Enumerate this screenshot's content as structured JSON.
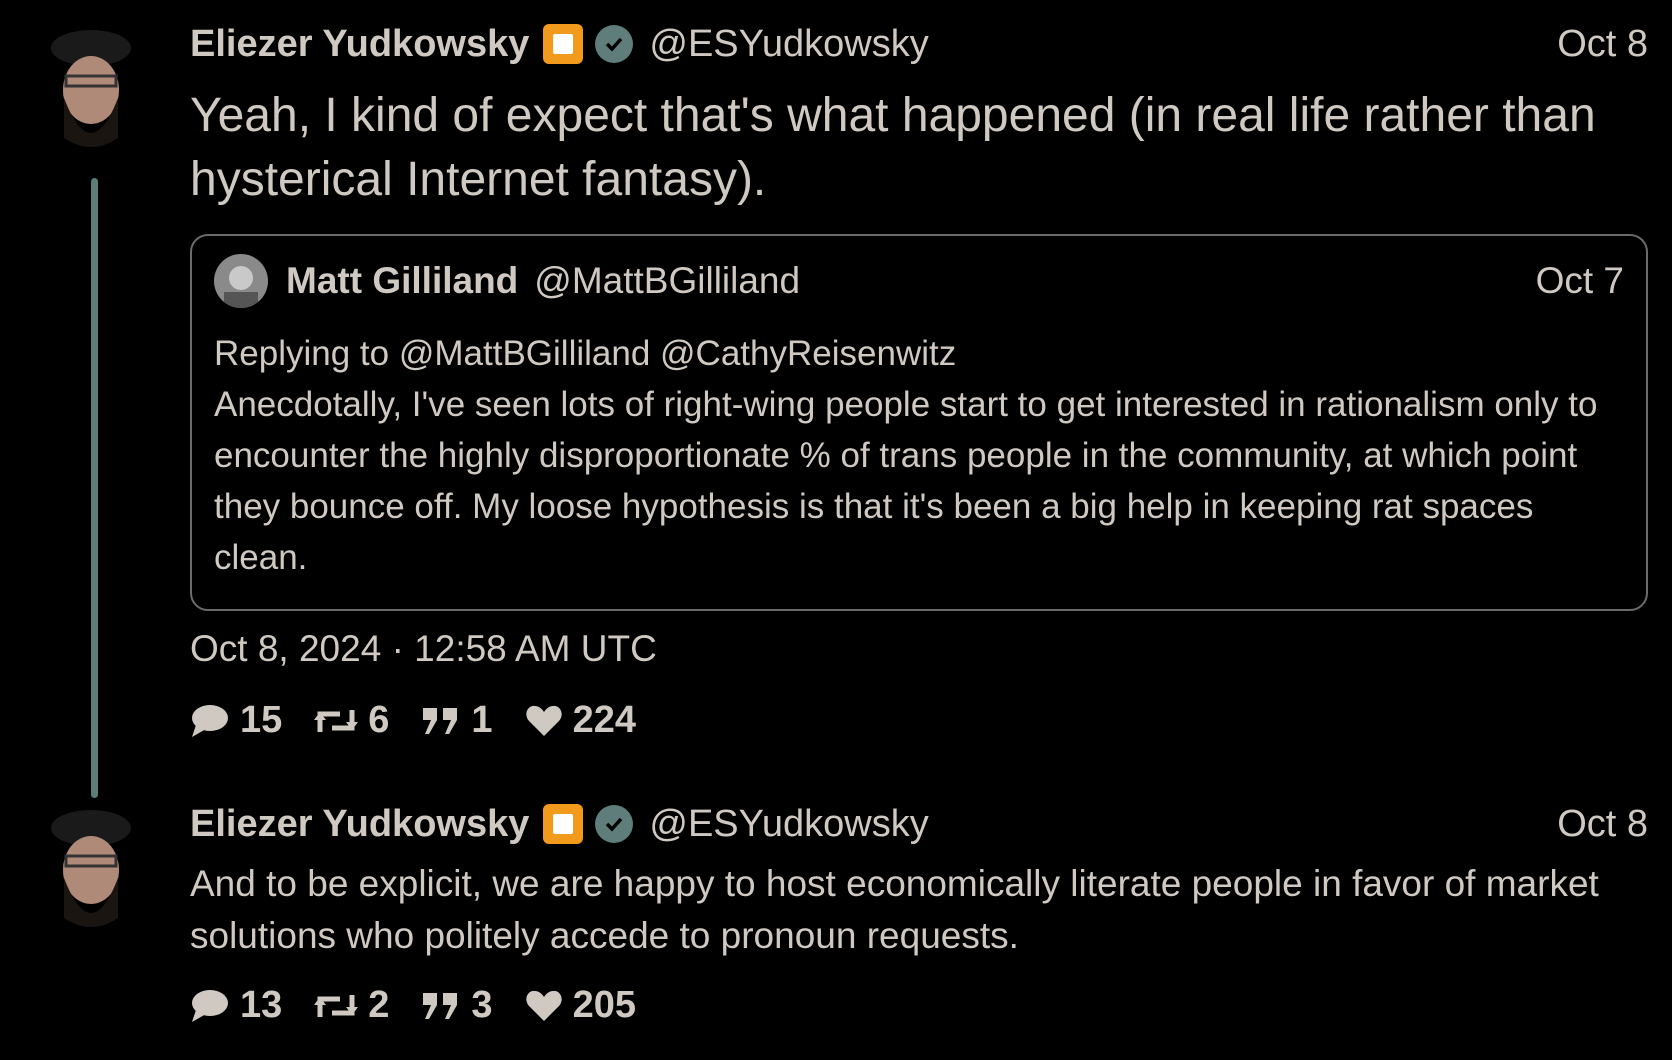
{
  "tweets": [
    {
      "name": "Eliezer Yudkowsky",
      "handle": "@ESYudkowsky",
      "date": "Oct 8",
      "text": "Yeah, I kind of expect that's what happened (in real life rather than hysterical Internet fantasy).",
      "quote": {
        "name": "Matt Gilliland",
        "handle": "@MattBGilliland",
        "date": "Oct 7",
        "replying_prefix": "Replying to",
        "replying_to": [
          "@MattBGilliland",
          "@CathyReisenwitz"
        ],
        "text": "Anecdotally, I've seen lots of right-wing people start to get interested in rationalism only to encounter the highly disproportionate % of trans people in the community, at which point they bounce off. My loose hypothesis is that it's been a big help in keeping rat spaces clean."
      },
      "timestamp": "Oct 8, 2024 · 12:58 AM UTC",
      "stats": {
        "replies": "15",
        "retweets": "6",
        "quotes": "1",
        "likes": "224"
      }
    },
    {
      "name": "Eliezer Yudkowsky",
      "handle": "@ESYudkowsky",
      "date": "Oct 8",
      "text": "And to be explicit, we are happy to host economically literate people in favor of market solutions who politely accede to pronoun requests.",
      "stats": {
        "replies": "13",
        "retweets": "2",
        "quotes": "3",
        "likes": "205"
      }
    }
  ],
  "colors": {
    "background": "#000000",
    "text": "#cfc9c1",
    "thread_line": "#5b7e7b",
    "badge": "#f29a1c",
    "verified": "#5f7d7a"
  },
  "icons": [
    "comment-icon",
    "retweet-icon",
    "quote-icon",
    "heart-icon",
    "verified-icon"
  ]
}
